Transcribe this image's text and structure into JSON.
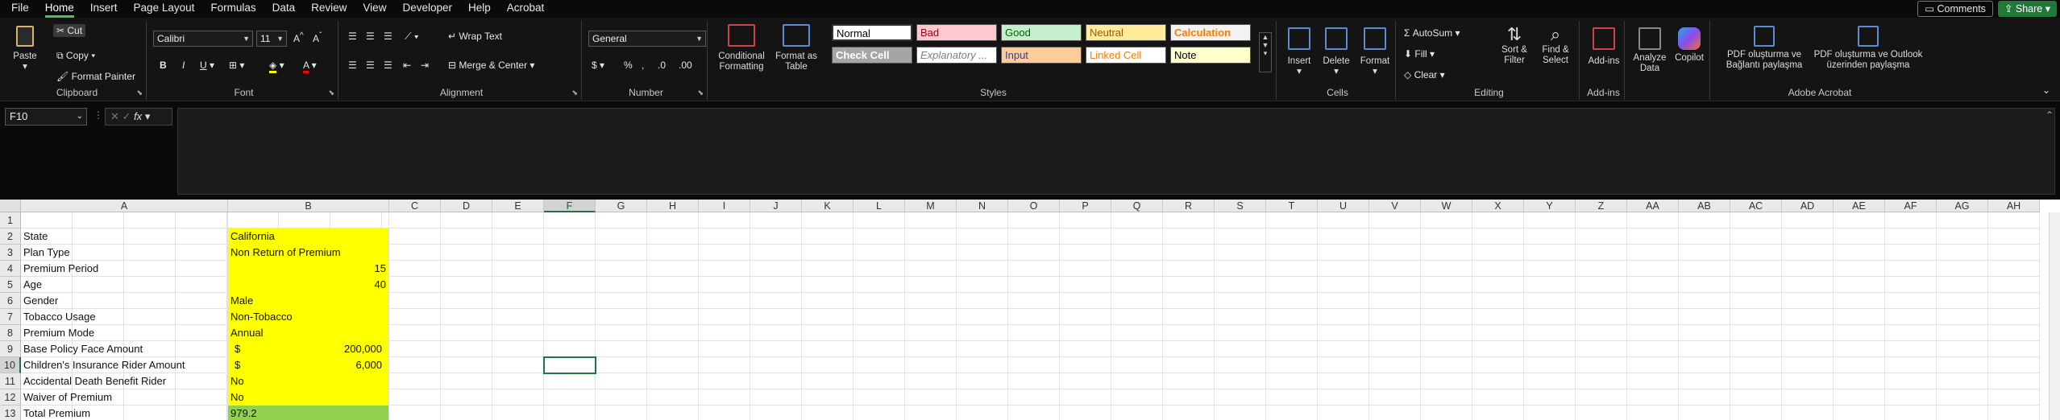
{
  "menu": {
    "items": [
      "File",
      "Home",
      "Insert",
      "Page Layout",
      "Formulas",
      "Data",
      "Review",
      "View",
      "Developer",
      "Help",
      "Acrobat"
    ],
    "active": "Home",
    "comments": "Comments",
    "share": "Share"
  },
  "clipboard": {
    "paste": "Paste",
    "cut": "Cut",
    "copy": "Copy",
    "format_painter": "Format Painter",
    "label": "Clipboard"
  },
  "font": {
    "name": "Calibri",
    "size": "11",
    "label": "Font",
    "bold": "B",
    "italic": "I",
    "underline": "U"
  },
  "alignment": {
    "wrap": "Wrap Text",
    "merge": "Merge & Center",
    "label": "Alignment"
  },
  "number": {
    "format": "General",
    "label": "Number"
  },
  "styles": {
    "conditional": "Conditional Formatting",
    "format_table": "Format as Table",
    "label": "Styles",
    "cells": [
      {
        "text": "Normal",
        "bg": "#ffffff",
        "fg": "#000000"
      },
      {
        "text": "Bad",
        "bg": "#ffc7ce",
        "fg": "#9c0006"
      },
      {
        "text": "Good",
        "bg": "#c6efce",
        "fg": "#006100"
      },
      {
        "text": "Neutral",
        "bg": "#ffeb9c",
        "fg": "#9c5700"
      },
      {
        "text": "Calculation",
        "bg": "#f2f2f2",
        "fg": "#fa7d00"
      },
      {
        "text": "Check Cell",
        "bg": "#a5a5a5",
        "fg": "#ffffff"
      },
      {
        "text": "Explanatory ...",
        "bg": "#ffffff",
        "fg": "#7f7f7f"
      },
      {
        "text": "Input",
        "bg": "#ffcc99",
        "fg": "#3f3f76"
      },
      {
        "text": "Linked Cell",
        "bg": "#ffffff",
        "fg": "#fa7d00"
      },
      {
        "text": "Note",
        "bg": "#ffffcc",
        "fg": "#000000"
      }
    ]
  },
  "cells_group": {
    "insert": "Insert",
    "delete": "Delete",
    "format": "Format",
    "label": "Cells"
  },
  "editing": {
    "autosum": "AutoSum",
    "fill": "Fill",
    "clear": "Clear",
    "sort": "Sort & Filter",
    "find": "Find & Select",
    "label": "Editing"
  },
  "addins": {
    "addins": "Add-ins",
    "analyze": "Analyze Data",
    "copilot": "Copilot",
    "label": "Add-ins"
  },
  "acrobat": {
    "pdf1": "PDF oluşturma ve Bağlantı paylaşma",
    "pdf2": "PDF oluşturma ve Outlook üzerinden paylaşma",
    "label": "Adobe Acrobat"
  },
  "namebox": "F10",
  "fx": "fx",
  "columns": [
    "A",
    "B",
    "C",
    "D",
    "E",
    "F",
    "G",
    "H",
    "I",
    "J",
    "K",
    "L",
    "M",
    "N",
    "O",
    "P",
    "Q",
    "R",
    "S",
    "T",
    "U",
    "V",
    "W",
    "X",
    "Y",
    "Z",
    "AA",
    "AB",
    "AC",
    "AD",
    "AE",
    "AF",
    "AG",
    "AH"
  ],
  "rows": [
    {
      "n": "1",
      "a": "",
      "b": "",
      "bstyle": ""
    },
    {
      "n": "2",
      "a": "State",
      "b": "California",
      "bstyle": "yellow"
    },
    {
      "n": "3",
      "a": "Plan Type",
      "b": "Non Return of Premium",
      "bstyle": "yellow"
    },
    {
      "n": "4",
      "a": "Premium Period",
      "b": "15",
      "bstyle": "yellow num"
    },
    {
      "n": "5",
      "a": "Age",
      "b": "40",
      "bstyle": "yellow num"
    },
    {
      "n": "6",
      "a": "Gender",
      "b": "Male",
      "bstyle": "yellow"
    },
    {
      "n": "7",
      "a": "Tobacco Usage",
      "b": "Non-Tobacco",
      "bstyle": "yellow"
    },
    {
      "n": "8",
      "a": "Premium Mode",
      "b": "Annual",
      "bstyle": "yellow"
    },
    {
      "n": "9",
      "a": "Base Policy Face Amount",
      "b": "200,000",
      "cur": "$",
      "bstyle": "yellow"
    },
    {
      "n": "10",
      "a": "Children's Insurance Rider Amount",
      "b": "6,000",
      "cur": "$",
      "bstyle": "yellow"
    },
    {
      "n": "11",
      "a": "Accidental Death Benefit Rider",
      "b": "No",
      "bstyle": "yellow"
    },
    {
      "n": "12",
      "a": "Waiver of Premium",
      "b": "No",
      "bstyle": "yellow"
    },
    {
      "n": "13",
      "a": "Total Premium",
      "b": "979.2",
      "bstyle": "green"
    }
  ]
}
